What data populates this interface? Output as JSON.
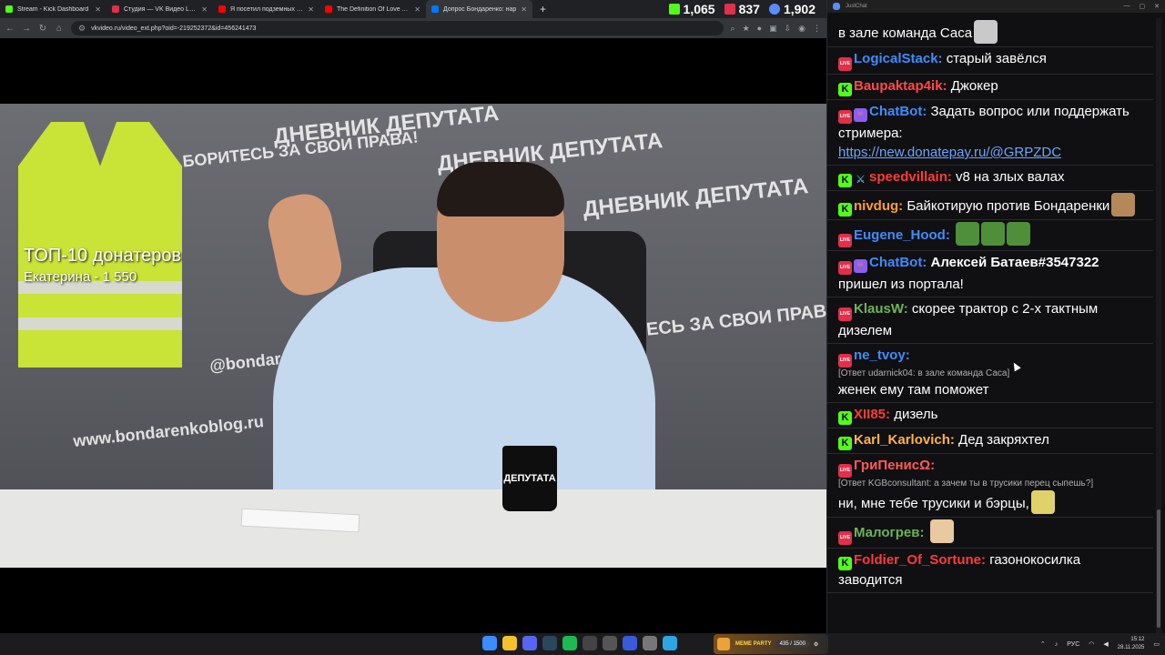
{
  "browser": {
    "tabs": [
      {
        "label": "Stream - Kick Dashboard",
        "color": "#53fc18",
        "active": false
      },
      {
        "label": "Студия — VK Видео Live",
        "color": "#e0304a",
        "active": false
      },
      {
        "label": "Я посетил подземных кротов",
        "color": "#ff0000",
        "active": false
      },
      {
        "label": "The Definition Of Love At First",
        "color": "#ff0000",
        "active": false
      },
      {
        "label": "Допрос Бондаренко: нар",
        "color": "#0077ff",
        "active": true
      }
    ],
    "new_tab_glyph": "+",
    "url": "vkvideo.ru/video_ext.php?oid=-219252372&id=456241473"
  },
  "stats": {
    "kick_viewers": "1,065",
    "vk_viewers": "837",
    "total_viewers": "1,902"
  },
  "video": {
    "overlay_title": "ТОП-10 донатеров",
    "overlay_sub": "Екатерина - 1 550",
    "mug_text": "ДЕПУТАТА",
    "backdrop_texts": [
      "ДНЕВНИК ДЕПУТАТА",
      "БОРИТЕСЬ ЗА СВОИ ПРАВА!",
      "@bondarenkoblog",
      "www.bondarenkoblog.ru"
    ]
  },
  "chat": {
    "window_title": "JustChat",
    "messages": [
      {
        "platform": "none",
        "user": "",
        "color": "#ffffff",
        "text": "в зале команда Саса",
        "emote": "#c9c9c9"
      },
      {
        "platform": "live",
        "user": "LogicalStack:",
        "color": "#3f8cff",
        "text": "старый завёлся"
      },
      {
        "platform": "kick",
        "user": "Baupaktap4ik:",
        "color": "#ff4a4a",
        "text": "Джокер"
      },
      {
        "platform": "live",
        "bot": true,
        "user": "ChatBot:",
        "color": "#3f8cff",
        "text": "Задать вопрос или поддержать стримера:",
        "link": "https://new.donatepay.ru/@GRPZDC"
      },
      {
        "platform": "kick",
        "sword": true,
        "user": "speedvillain:",
        "color": "#ff3b3b",
        "text": "v8 на злых валах"
      },
      {
        "platform": "kick",
        "user": "nivdug:",
        "color": "#ff9d2f",
        "text": "Байкотирую против Бондаренки",
        "emote": "#b5885a"
      },
      {
        "platform": "live",
        "user": "Eugene_Hood:",
        "color": "#3f8cff",
        "text": "",
        "emotes": [
          "#4f8f3a",
          "#4f8f3a",
          "#4f8f3a"
        ]
      },
      {
        "platform": "live",
        "bot": true,
        "user": "ChatBot:",
        "color": "#3f8cff",
        "bold_text": "Алексей Батаев#3547322",
        "text": "пришел из портала!"
      },
      {
        "platform": "live",
        "user": "KlausW:",
        "color": "#6fb25a",
        "text": "скорее трактор с 2-х тактным дизелем"
      },
      {
        "platform": "live",
        "user": "ne_tvoy:",
        "color": "#3f8cff",
        "reply": "[Ответ udarnick04: в зале команда Саса]",
        "text": "женек ему там поможет"
      },
      {
        "platform": "kick",
        "user": "XII85:",
        "color": "#ff3b3b",
        "text": "дизель"
      },
      {
        "platform": "kick",
        "user": "Karl_Karlovich:",
        "color": "#ffb347",
        "text": "Дед закряхтел"
      },
      {
        "platform": "live",
        "user": "ГриПенисΩ:",
        "color": "#ff5a5a",
        "reply": "[Ответ KGBconsultant: а зачем ты в трусики перец сыпешь?]",
        "text": "ни, мне тебе трусики и бэрцы,",
        "emote": "#e0d26a"
      },
      {
        "platform": "live",
        "user": "Малогрев:",
        "color": "#6fb25a",
        "text": "",
        "emote": "#e8c9a0"
      },
      {
        "platform": "kick",
        "user": "Foldier_Of_Sortune:",
        "color": "#ff3b3b",
        "text": "газонокосилка заводится"
      }
    ]
  },
  "taskbar": {
    "meme_title": "MEME PARTY",
    "meme_count": "435 / 1500",
    "lang": "РУС",
    "time": "15:12",
    "date": "28.11.2025"
  }
}
